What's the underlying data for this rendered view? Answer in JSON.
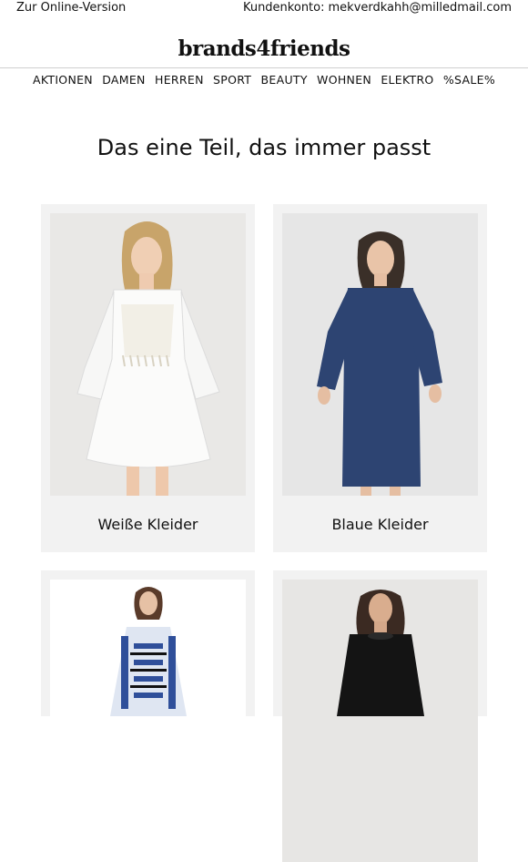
{
  "topbar": {
    "online_version": "Zur Online-Version",
    "account_label": "Kundenkonto:",
    "account_email": "mekverdkahh@milledmail.com"
  },
  "logo": "brands4friends",
  "nav": [
    "AKTIONEN",
    "DAMEN",
    "HERREN",
    "SPORT",
    "BEAUTY",
    "WOHNEN",
    "ELEKTRO",
    "%SALE%"
  ],
  "headline": "Das eine Teil, das immer passt",
  "products": [
    {
      "label": "Weiße Kleider"
    },
    {
      "label": "Blaue Kleider"
    }
  ],
  "colors": {
    "card_bg": "#f2f2f2",
    "divider": "#cfcfcf",
    "text": "#111111"
  }
}
